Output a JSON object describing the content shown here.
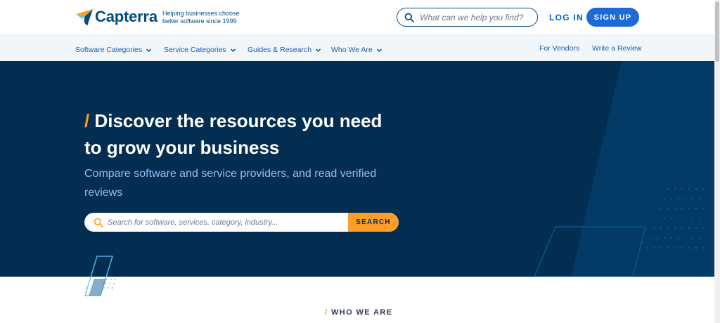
{
  "brand": {
    "name": "Capterra",
    "tagline_line1": "Helping businesses choose",
    "tagline_line2": "better software since 1999"
  },
  "header": {
    "search_placeholder": "What can we help you find?",
    "login_label": "LOG IN",
    "signup_label": "SIGN UP"
  },
  "nav": {
    "items": [
      {
        "label": "Software Categories"
      },
      {
        "label": "Service Categories"
      },
      {
        "label": "Guides & Research"
      },
      {
        "label": "Who We Are"
      }
    ],
    "right_links": [
      {
        "label": "For Vendors"
      },
      {
        "label": "Write a Review"
      }
    ]
  },
  "hero": {
    "slash": "/",
    "title_line1": "Discover the resources you need",
    "title_line2": "to grow your business",
    "subtitle_line1": "Compare software and service providers, and read verified",
    "subtitle_line2": "reviews",
    "search_placeholder": "Search for software, services, category, industry...",
    "search_button": "SEARCH"
  },
  "section": {
    "slash": "/",
    "label": "WHO WE ARE"
  },
  "colors": {
    "brand_blue": "#044d80",
    "hero_bg": "#032e51",
    "accent_orange": "#ff9d28",
    "primary_button": "#1b6ad6",
    "nav_bg": "#f1f6fa",
    "subtitle": "#8fc0ee"
  },
  "icons": [
    "capterra-logo-icon",
    "search-icon",
    "chevron-down-icon"
  ]
}
